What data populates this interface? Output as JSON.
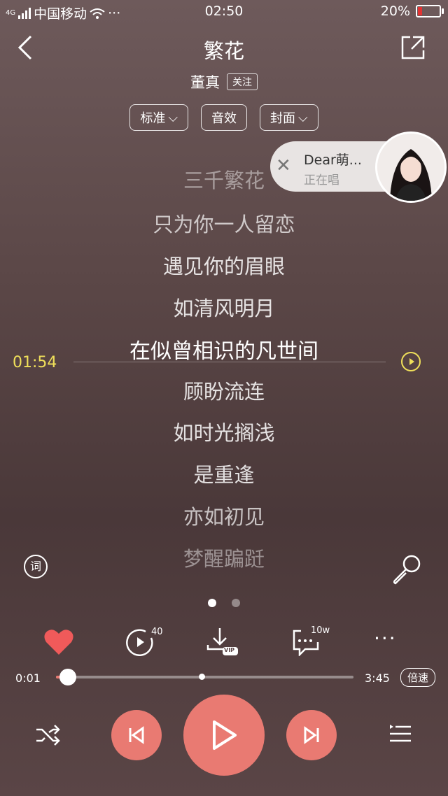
{
  "status": {
    "network": "4G",
    "carrier": "中国移动",
    "time": "02:50",
    "battery_pct": "20%",
    "battery_level": 0.2,
    "battery_color": "#e33333"
  },
  "header": {
    "title": "繁花",
    "artist": "董真",
    "follow_label": "关注"
  },
  "pills": [
    {
      "label": "标准"
    },
    {
      "label": "音效"
    },
    {
      "label": "封面"
    }
  ],
  "float_card": {
    "name": "Dear萌...",
    "status": "正在唱"
  },
  "lyrics": [
    {
      "text": "三千繁花"
    },
    {
      "text": "只为你一人留恋"
    },
    {
      "text": "遇见你的眉眼"
    },
    {
      "text": "如清风明月"
    },
    {
      "text": "在似曾相识的凡世间"
    },
    {
      "text": "顾盼流连"
    },
    {
      "text": "如时光搁浅"
    },
    {
      "text": "是重逢"
    },
    {
      "text": "亦如初见"
    },
    {
      "text": "梦醒蹁跹"
    }
  ],
  "seek_time": "01:54",
  "actions": {
    "mv_count": "40",
    "comment_count": "10w",
    "download_badge": "VIP"
  },
  "player": {
    "current": "0:01",
    "total": "3:45",
    "progress": 0.04,
    "buffered": 0.49,
    "speed_label": "倍速"
  },
  "colors": {
    "accent": "#e97a72",
    "highlight": "#f0e05a",
    "like": "#f05a5a"
  }
}
